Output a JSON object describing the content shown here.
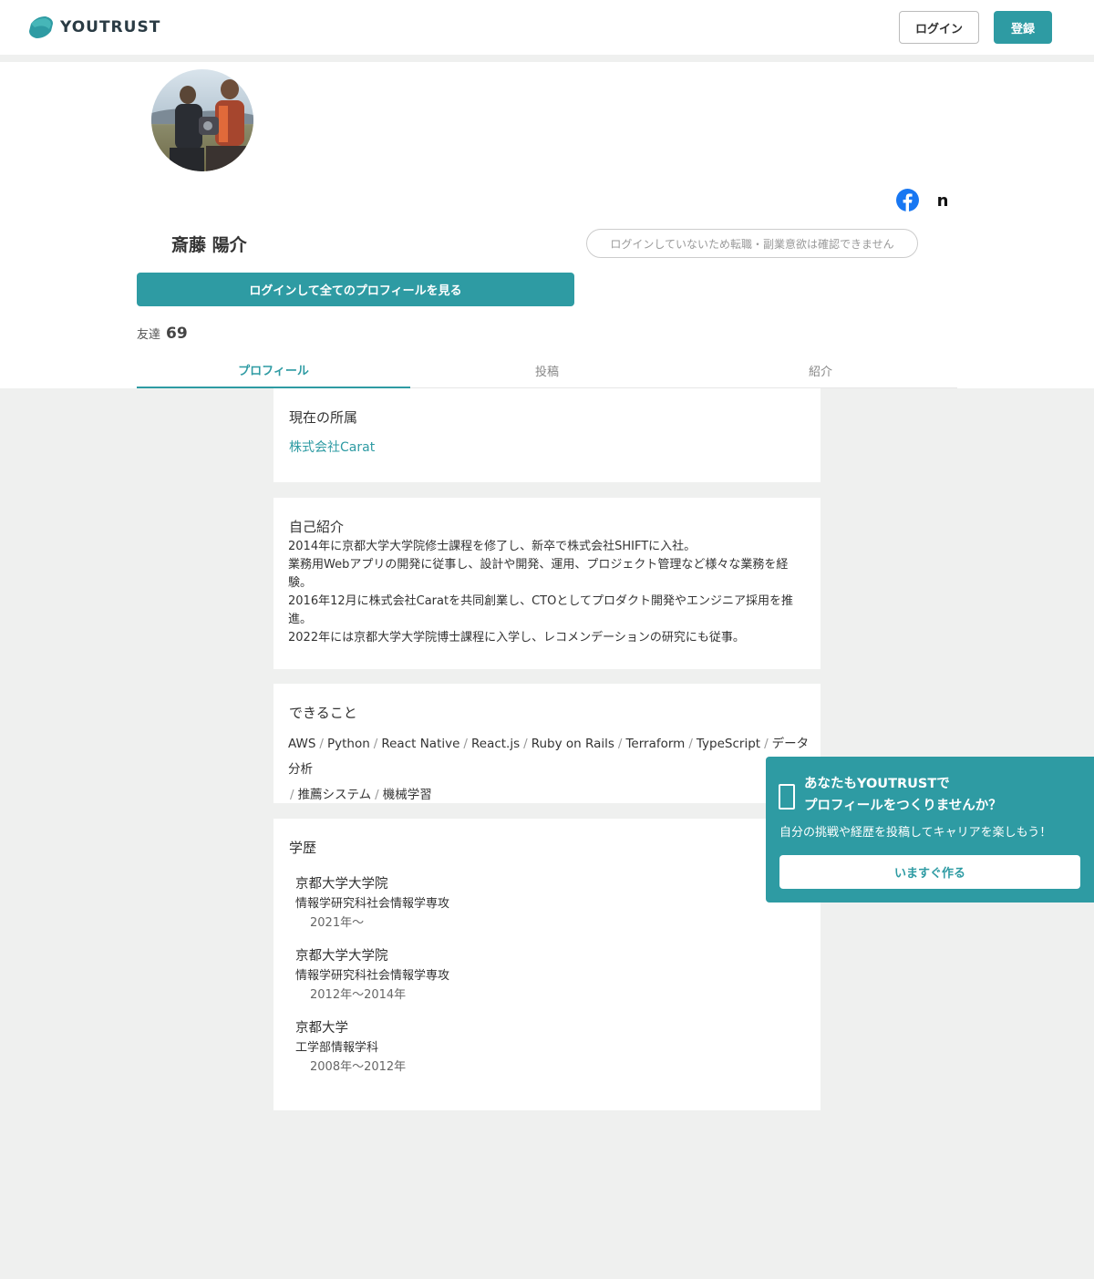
{
  "header": {
    "logo_text": "YOUTRUST",
    "login_label": "ログイン",
    "register_label": "登録"
  },
  "profile": {
    "name": "斎藤 陽介",
    "status_notice": "ログインしていないため転職・副業意欲は確認できません",
    "view_full_label": "ログインして全てのプロフィールを見る",
    "friends_label": "友達",
    "friends_count": "69",
    "social_icons": [
      "facebook-icon",
      "note-icon"
    ],
    "note_glyph": "n"
  },
  "tabs": [
    {
      "label": "プロフィール",
      "active": true
    },
    {
      "label": "投稿",
      "active": false
    },
    {
      "label": "紹介",
      "active": false
    }
  ],
  "affiliation": {
    "title": "現在の所属",
    "company": "株式会社Carat"
  },
  "intro": {
    "title": "自己紹介",
    "lines": [
      "2014年に京都大学大学院修士課程を修了し、新卒で株式会社SHIFTに入社。",
      "業務用Webアプリの開発に従事し、設計や開発、運用、プロジェクト管理など様々な業務を経験。",
      "2016年12月に株式会社Caratを共同創業し、CTOとしてプロダクト開発やエンジニア採用を推進。",
      "2022年には京都大学大学院博士課程に入学し、レコメンデーションの研究にも従事。"
    ]
  },
  "skills": {
    "title": "できること",
    "separator": "/",
    "items": [
      "AWS",
      "Python",
      "React Native",
      "React.js",
      "Ruby on Rails",
      "Terraform",
      "TypeScript",
      "データ分析",
      "推薦システム",
      "機械学習"
    ]
  },
  "education": {
    "title": "学歴",
    "items": [
      {
        "school": "京都大学大学院",
        "dept": "情報学研究科社会情報学専攻",
        "period": "2021年〜"
      },
      {
        "school": "京都大学大学院",
        "dept": "情報学研究科社会情報学専攻",
        "period": "2012年〜2014年"
      },
      {
        "school": "京都大学",
        "dept": "工学部情報学科",
        "period": "2008年〜2012年"
      }
    ]
  },
  "promo": {
    "title_line1": "あなたもYOUTRUSTで",
    "title_line2": "プロフィールをつくりませんか？",
    "subtitle": "自分の挑戦や経歴を投稿してキャリアを楽しもう！",
    "button_label": "いますぐ作る"
  },
  "colors": {
    "accent": "#2e9ba3",
    "page_bg": "#eff0ef",
    "facebook": "#1877f2"
  }
}
